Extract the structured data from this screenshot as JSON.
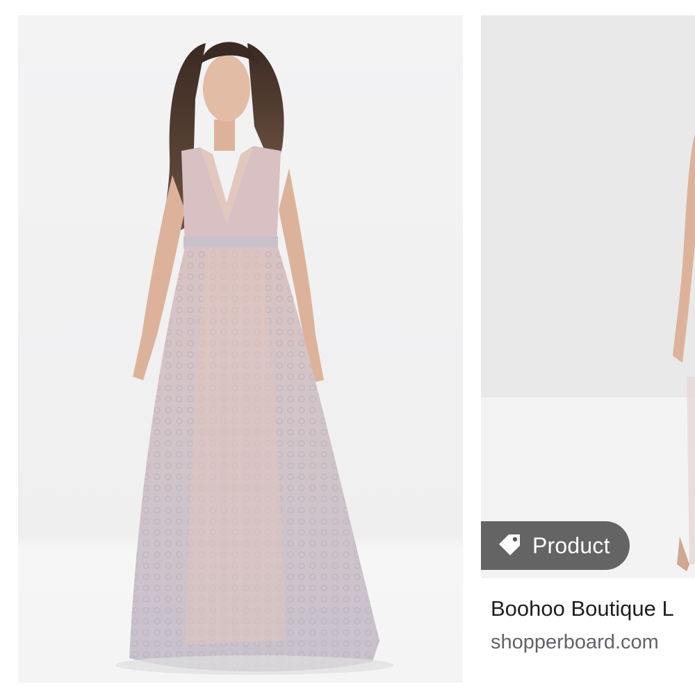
{
  "results": [
    {
      "image_description_icon": "dress-photo-icon"
    },
    {
      "badge_label": "Product",
      "badge_icon": "tag-icon",
      "title": "Boohoo Boutique L",
      "source": "shopperboard.com"
    }
  ],
  "colors": {
    "badge_bg": "#585858",
    "caption_title": "#1e1e1e",
    "caption_source": "#5f6368",
    "card_bg": "#f1f1f1"
  }
}
